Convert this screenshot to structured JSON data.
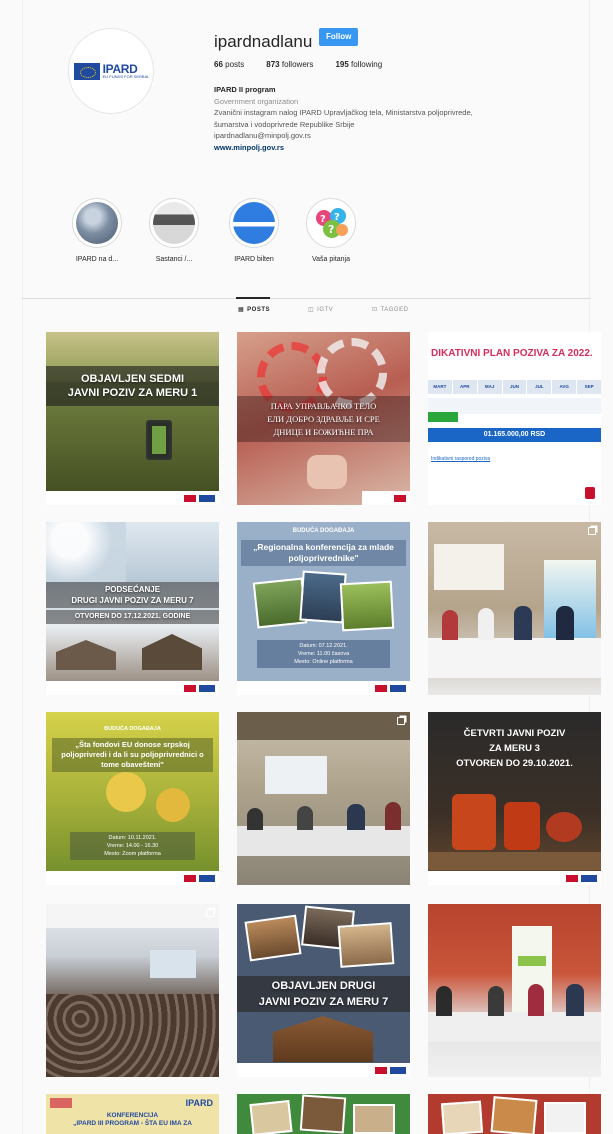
{
  "profile": {
    "username": "ipardnadlanu",
    "follow_label": "Follow",
    "logo_main": "IPARD",
    "logo_sub": "EU FUNDS FOR SERBIA",
    "stats": {
      "posts": "66",
      "posts_label": "posts",
      "followers": "873",
      "followers_label": "followers",
      "following": "195",
      "following_label": "following"
    },
    "bio": {
      "name": "IPARD II program",
      "category": "Government organization",
      "line1": "Zvanični instagram nalog IPARD Upravljačkog tela, Ministarstva poljoprivrede,",
      "line2": "šumarstva i vodoprivrede Republike Srbije",
      "email": "ipardnadlanu@minpolj.gov.rs",
      "link": "www.minpolj.gov.rs"
    }
  },
  "highlights": [
    {
      "label": "IPARD na d..."
    },
    {
      "label": "Sastanci /..."
    },
    {
      "label": "IPARD bilten"
    },
    {
      "label": "Vaša pitanja"
    }
  ],
  "tabs": [
    {
      "label": "POSTS",
      "icon": "grid-icon"
    },
    {
      "label": "IGTV",
      "icon": "igtv-icon"
    },
    {
      "label": "TAGGED",
      "icon": "tag-icon"
    }
  ],
  "posts": {
    "p1": {
      "line1": "OBJAVLJEN SEDMI",
      "line2": "JAVNI POZIV ZA MERU 1"
    },
    "p2": {
      "line1": "ПАРА УПРАВЉАЧКО ТЕЛО",
      "line2": "ЕЛИ ДОБРО ЗДРАВЉЕ И СРЕ",
      "line3": "ДНИЦЕ И БОЖИЋНЕ ПРА"
    },
    "p3": {
      "title": "DIKATIVNI PLAN POZIVA ZA 2022.",
      "months": [
        "MART",
        "APR",
        "MAJ",
        "JUN",
        "JUL",
        "AVG",
        "SEP"
      ],
      "amount": "01.165.000,00 RSD",
      "note": "Indikativni raspored poziva"
    },
    "p4": {
      "line1": "PODSEĆANJE",
      "line2": "DRUGI JAVNI POZIV ZA MERU 7",
      "line3": "OTVOREN DO 17.12.2021. GODINE"
    },
    "p5": {
      "tag": "BUDUĆA DOGAĐAJA",
      "title": "„Regionalna konferencija za mlade poljoprivrednike\"",
      "date": "Datum: 07.12.2021.",
      "time": "Vreme: 11.00 časova",
      "place": "Mesto: Online platforma"
    },
    "p7": {
      "tag": "BUDUĆA DOGAĐAJA",
      "title": "„Šta fondovi EU donose srpskoj poljoprivredi i da li su poljoprivrednici o tome obavešteni\"",
      "date": "Datum: 10.11.2021.",
      "time": "Vreme: 14.00 - 16.30",
      "place": "Mesto: Zoom platforma"
    },
    "p9": {
      "line1": "ČETVRTI JAVNI POZIV",
      "line2": "ZA MERU 3",
      "line3": "OTVOREN DO 29.10.2021."
    },
    "p11": {
      "line1": "OBJAVLJEN DRUGI",
      "line2": "JAVNI POZIV ZA MERU 7"
    },
    "p13": {
      "line1": "KONFERENCIJA",
      "line2": "„IPARD III PROGRAM - ŠTA EU IMA ZA",
      "logo": "IPARD"
    }
  },
  "colors": {
    "accent": "#3897f0",
    "eu_blue": "#1f4aa0",
    "text": "#262626",
    "muted": "#8e8e8e"
  }
}
